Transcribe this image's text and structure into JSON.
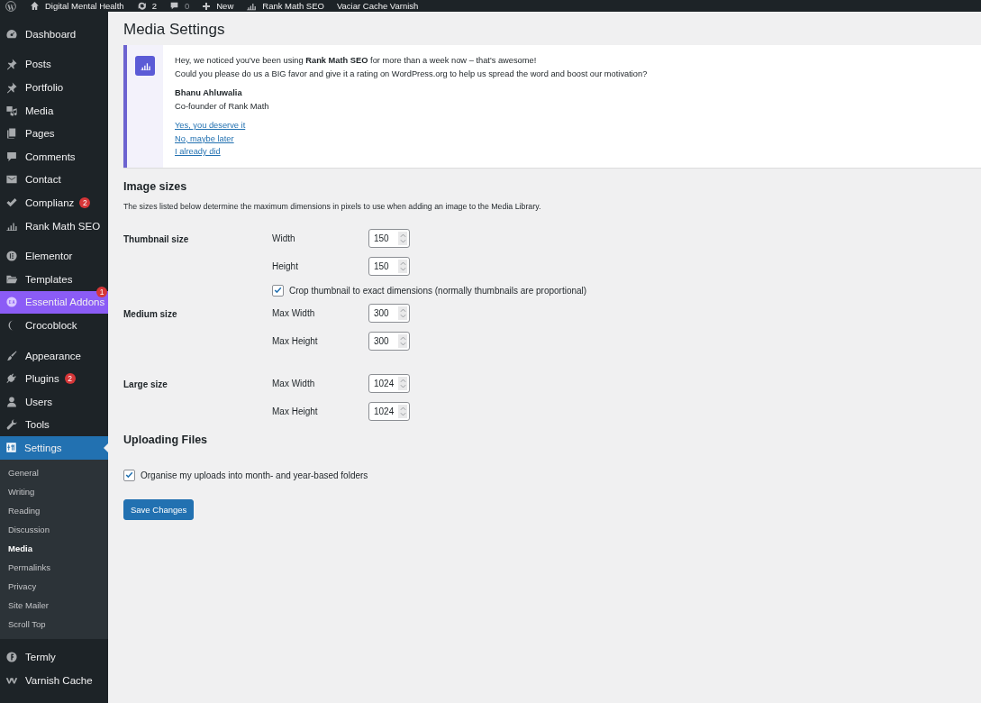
{
  "admin_bar": {
    "items": [
      {
        "label": "Digital Mental Health",
        "muted": false
      },
      {
        "label": "2",
        "muted": false
      },
      {
        "label": "0",
        "muted": true
      },
      {
        "label": "New",
        "muted": false
      },
      {
        "label": "Rank Math SEO",
        "muted": false
      },
      {
        "label": "Vaciar Cache Varnish",
        "muted": false
      }
    ]
  },
  "sidebar": {
    "groups": [
      {
        "items": [
          {
            "label": "Dashboard",
            "highlighted": false,
            "selected": false
          }
        ]
      },
      {
        "items": [
          {
            "label": "Posts",
            "highlighted": false,
            "selected": false
          },
          {
            "label": "Portfolio",
            "highlighted": false,
            "selected": false
          },
          {
            "label": "Media",
            "highlighted": false,
            "selected": false
          },
          {
            "label": "Pages",
            "highlighted": false,
            "selected": false
          },
          {
            "label": "Comments",
            "highlighted": false,
            "selected": false
          },
          {
            "label": "Contact",
            "highlighted": false,
            "selected": false
          },
          {
            "label": "Complianz",
            "badge": "2",
            "highlighted": false,
            "selected": false
          },
          {
            "label": "Rank Math SEO",
            "highlighted": false,
            "selected": false
          }
        ]
      },
      {
        "items": [
          {
            "label": "Elementor",
            "highlighted": false,
            "selected": false
          },
          {
            "label": "Templates",
            "highlighted": false,
            "selected": false
          },
          {
            "label": "Essential Addons",
            "badge": "1",
            "highlighted": true,
            "selected": false
          },
          {
            "label": "Crocoblock",
            "highlighted": false,
            "selected": false
          }
        ]
      },
      {
        "items": [
          {
            "label": "Appearance",
            "highlighted": false,
            "selected": false
          },
          {
            "label": "Plugins",
            "badge": "2",
            "highlighted": false,
            "selected": false
          },
          {
            "label": "Users",
            "highlighted": false,
            "selected": false
          },
          {
            "label": "Tools",
            "highlighted": false,
            "selected": false
          },
          {
            "label": "Settings",
            "highlighted": false,
            "selected": true,
            "submenu": [
              {
                "label": "General",
                "selected": false
              },
              {
                "label": "Writing",
                "selected": false
              },
              {
                "label": "Reading",
                "selected": false
              },
              {
                "label": "Discussion",
                "selected": false
              },
              {
                "label": "Media",
                "selected": true
              },
              {
                "label": "Permalinks",
                "selected": false
              },
              {
                "label": "Privacy",
                "selected": false
              },
              {
                "label": "Site Mailer",
                "selected": false
              },
              {
                "label": "Scroll Top",
                "selected": false
              }
            ]
          }
        ]
      },
      {
        "items": [
          {
            "label": "Termly",
            "highlighted": false,
            "selected": false
          },
          {
            "label": "Varnish Cache",
            "highlighted": false,
            "selected": false
          }
        ]
      }
    ]
  },
  "page": {
    "title": "Media Settings",
    "notice": {
      "lines": [
        "Hey, we noticed you've been using **Rank Math SEO** for more than a week now – that's awesome!",
        "Could you please do us a BIG favor and give it a rating on WordPress.org to help us spread the word and boost our motivation?"
      ],
      "author": "Bhanu Ahluwalia",
      "role": "Co-founder of Rank Math",
      "links": [
        "Yes, you deserve it",
        "No, maybe later",
        "I already did"
      ]
    },
    "sections": [
      {
        "heading": "Image sizes",
        "description": "The sizes listed below determine the maximum dimensions in pixels to use when adding an image to the Media Library.",
        "rows": [
          {
            "label": "Thumbnail size",
            "fields": [
              {
                "kind": "number",
                "label": "Width",
                "value": "150"
              },
              {
                "kind": "number",
                "label": "Height",
                "value": "150"
              },
              {
                "kind": "checkbox",
                "label": "Crop thumbnail to exact dimensions (normally thumbnails are proportional)",
                "checked": true
              }
            ]
          },
          {
            "label": "Medium size",
            "fields": [
              {
                "kind": "number",
                "label": "Max Width",
                "value": "300"
              },
              {
                "kind": "number",
                "label": "Max Height",
                "value": "300"
              }
            ]
          },
          {
            "label": "Large size",
            "fields": [
              {
                "kind": "number",
                "label": "Max Width",
                "value": "1024"
              },
              {
                "kind": "number",
                "label": "Max Height",
                "value": "1024"
              }
            ]
          }
        ]
      },
      {
        "heading": "Uploading Files",
        "rows": [
          {
            "fields": [
              {
                "kind": "checkbox",
                "label": "Organise my uploads into month- and year-based folders",
                "checked": true
              }
            ]
          }
        ]
      }
    ],
    "save_button": "Save Changes"
  }
}
